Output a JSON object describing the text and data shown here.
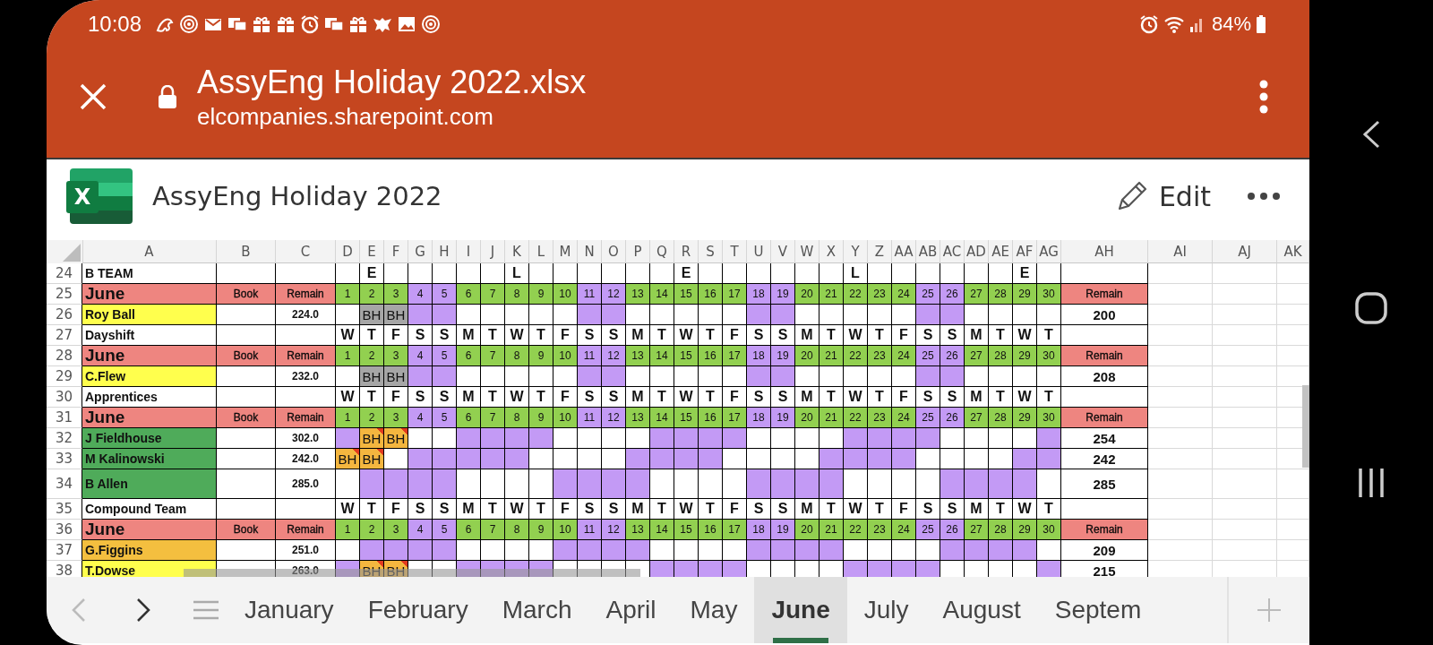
{
  "status_bar": {
    "time": "10:08",
    "battery": "84%"
  },
  "app_bar": {
    "title": "AssyEng Holiday 2022.xlsx",
    "url": "elcompanies.sharepoint.com"
  },
  "document": {
    "logo_letter": "X",
    "title": "AssyEng Holiday 2022",
    "edit_label": "Edit"
  },
  "sheet": {
    "columns": [
      "A",
      "B",
      "C",
      "D",
      "E",
      "F",
      "G",
      "H",
      "I",
      "J",
      "K",
      "L",
      "M",
      "N",
      "O",
      "P",
      "Q",
      "R",
      "S",
      "T",
      "U",
      "V",
      "W",
      "X",
      "Y",
      "Z",
      "AA",
      "AB",
      "AC",
      "AD",
      "AE",
      "AF",
      "AG",
      "AH",
      "AI",
      "AJ",
      "AK"
    ],
    "rows": [
      {
        "number": "24",
        "kind": "team",
        "label": "B TEAM",
        "cells": [
          {
            "kind": "blank"
          },
          {
            "kind": "mark",
            "text": "E"
          },
          {
            "kind": "blank"
          },
          {
            "kind": "blank"
          },
          {
            "kind": "blank"
          },
          {
            "kind": "blank"
          },
          {
            "kind": "blank"
          },
          {
            "kind": "mark",
            "text": "L"
          },
          {
            "kind": "blank"
          },
          {
            "kind": "blank"
          },
          {
            "kind": "blank"
          },
          {
            "kind": "blank"
          },
          {
            "kind": "blank"
          },
          {
            "kind": "blank"
          },
          {
            "kind": "mark",
            "text": "E"
          },
          {
            "kind": "blank"
          },
          {
            "kind": "blank"
          },
          {
            "kind": "blank"
          },
          {
            "kind": "blank"
          },
          {
            "kind": "blank"
          },
          {
            "kind": "blank"
          },
          {
            "kind": "mark",
            "text": "L"
          },
          {
            "kind": "blank"
          },
          {
            "kind": "blank"
          },
          {
            "kind": "blank"
          },
          {
            "kind": "blank"
          },
          {
            "kind": "blank"
          },
          {
            "kind": "blank"
          },
          {
            "kind": "mark",
            "text": "E"
          },
          {
            "kind": "blank"
          }
        ]
      },
      {
        "number": "25",
        "kind": "header",
        "month": "June",
        "book": "Book",
        "remain": "Remain",
        "total_label": "Remain",
        "days": [
          {
            "label": "1",
            "weekend": false
          },
          {
            "label": "2",
            "weekend": false
          },
          {
            "label": "3",
            "weekend": false
          },
          {
            "label": "4",
            "weekend": true
          },
          {
            "label": "5",
            "weekend": true
          },
          {
            "label": "6",
            "weekend": false
          },
          {
            "label": "7",
            "weekend": false
          },
          {
            "label": "8",
            "weekend": false
          },
          {
            "label": "9",
            "weekend": false
          },
          {
            "label": "10",
            "weekend": false
          },
          {
            "label": "11",
            "weekend": true
          },
          {
            "label": "12",
            "weekend": true
          },
          {
            "label": "13",
            "weekend": false
          },
          {
            "label": "14",
            "weekend": false
          },
          {
            "label": "15",
            "weekend": false
          },
          {
            "label": "16",
            "weekend": false
          },
          {
            "label": "17",
            "weekend": false
          },
          {
            "label": "18",
            "weekend": true
          },
          {
            "label": "19",
            "weekend": true
          },
          {
            "label": "20",
            "weekend": false
          },
          {
            "label": "21",
            "weekend": false
          },
          {
            "label": "22",
            "weekend": false
          },
          {
            "label": "23",
            "weekend": false
          },
          {
            "label": "24",
            "weekend": false
          },
          {
            "label": "25",
            "weekend": true
          },
          {
            "label": "26",
            "weekend": true
          },
          {
            "label": "27",
            "weekend": false
          },
          {
            "label": "28",
            "weekend": false
          },
          {
            "label": "29",
            "weekend": false
          },
          {
            "label": "30",
            "weekend": false
          }
        ]
      },
      {
        "number": "26",
        "kind": "person",
        "name": "Roy Ball",
        "color": "#ffff4d",
        "hours": "224.0",
        "total": "200",
        "days": [
          {
            "kind": "blank"
          },
          {
            "kind": "holiday",
            "text": "BH",
            "color": "#a6a6a6",
            "note": false
          },
          {
            "kind": "holiday",
            "text": "BH",
            "color": "#a6a6a6",
            "note": false
          },
          {
            "kind": "off"
          },
          {
            "kind": "off"
          },
          {
            "kind": "blank"
          },
          {
            "kind": "blank"
          },
          {
            "kind": "blank"
          },
          {
            "kind": "blank"
          },
          {
            "kind": "blank"
          },
          {
            "kind": "off"
          },
          {
            "kind": "off"
          },
          {
            "kind": "blank"
          },
          {
            "kind": "blank"
          },
          {
            "kind": "blank"
          },
          {
            "kind": "blank"
          },
          {
            "kind": "blank"
          },
          {
            "kind": "off"
          },
          {
            "kind": "off"
          },
          {
            "kind": "blank"
          },
          {
            "kind": "blank"
          },
          {
            "kind": "blank"
          },
          {
            "kind": "blank"
          },
          {
            "kind": "blank"
          },
          {
            "kind": "off"
          },
          {
            "kind": "off"
          },
          {
            "kind": "blank"
          },
          {
            "kind": "blank"
          },
          {
            "kind": "blank"
          },
          {
            "kind": "blank"
          }
        ]
      },
      {
        "number": "27",
        "kind": "weekdays",
        "label": "Dayshift",
        "days": [
          "W",
          "T",
          "F",
          "S",
          "S",
          "M",
          "T",
          "W",
          "T",
          "F",
          "S",
          "S",
          "M",
          "T",
          "W",
          "T",
          "F",
          "S",
          "S",
          "M",
          "T",
          "W",
          "T",
          "F",
          "S",
          "S",
          "M",
          "T",
          "W",
          "T"
        ]
      },
      {
        "number": "28",
        "kind": "header",
        "month": "June",
        "book": "Book",
        "remain": "Remain",
        "total_label": "Remain",
        "days": [
          {
            "label": "1",
            "weekend": false
          },
          {
            "label": "2",
            "weekend": false
          },
          {
            "label": "3",
            "weekend": false
          },
          {
            "label": "4",
            "weekend": true
          },
          {
            "label": "5",
            "weekend": true
          },
          {
            "label": "6",
            "weekend": false
          },
          {
            "label": "7",
            "weekend": false
          },
          {
            "label": "8",
            "weekend": false
          },
          {
            "label": "9",
            "weekend": false
          },
          {
            "label": "10",
            "weekend": false
          },
          {
            "label": "11",
            "weekend": true
          },
          {
            "label": "12",
            "weekend": true
          },
          {
            "label": "13",
            "weekend": false
          },
          {
            "label": "14",
            "weekend": false
          },
          {
            "label": "15",
            "weekend": false
          },
          {
            "label": "16",
            "weekend": false
          },
          {
            "label": "17",
            "weekend": false
          },
          {
            "label": "18",
            "weekend": true
          },
          {
            "label": "19",
            "weekend": true
          },
          {
            "label": "20",
            "weekend": false
          },
          {
            "label": "21",
            "weekend": false
          },
          {
            "label": "22",
            "weekend": false
          },
          {
            "label": "23",
            "weekend": false
          },
          {
            "label": "24",
            "weekend": false
          },
          {
            "label": "25",
            "weekend": true
          },
          {
            "label": "26",
            "weekend": true
          },
          {
            "label": "27",
            "weekend": false
          },
          {
            "label": "28",
            "weekend": false
          },
          {
            "label": "29",
            "weekend": false
          },
          {
            "label": "30",
            "weekend": false
          }
        ]
      },
      {
        "number": "29",
        "kind": "person",
        "name": "C.Flew",
        "color": "#ffff4d",
        "hours": "232.0",
        "total": "208",
        "days": [
          {
            "kind": "blank"
          },
          {
            "kind": "holiday",
            "text": "BH",
            "color": "#a6a6a6",
            "note": false
          },
          {
            "kind": "holiday",
            "text": "BH",
            "color": "#a6a6a6",
            "note": false
          },
          {
            "kind": "off"
          },
          {
            "kind": "off"
          },
          {
            "kind": "blank"
          },
          {
            "kind": "blank"
          },
          {
            "kind": "blank"
          },
          {
            "kind": "blank"
          },
          {
            "kind": "blank"
          },
          {
            "kind": "off"
          },
          {
            "kind": "off"
          },
          {
            "kind": "blank"
          },
          {
            "kind": "blank"
          },
          {
            "kind": "blank"
          },
          {
            "kind": "blank"
          },
          {
            "kind": "blank"
          },
          {
            "kind": "off"
          },
          {
            "kind": "off"
          },
          {
            "kind": "blank"
          },
          {
            "kind": "blank"
          },
          {
            "kind": "blank"
          },
          {
            "kind": "blank"
          },
          {
            "kind": "blank"
          },
          {
            "kind": "off"
          },
          {
            "kind": "off"
          },
          {
            "kind": "blank"
          },
          {
            "kind": "blank"
          },
          {
            "kind": "blank"
          },
          {
            "kind": "blank"
          }
        ]
      },
      {
        "number": "30",
        "kind": "weekdays",
        "label": "Apprentices",
        "days": [
          "W",
          "T",
          "F",
          "S",
          "S",
          "M",
          "T",
          "W",
          "T",
          "F",
          "S",
          "S",
          "M",
          "T",
          "W",
          "T",
          "F",
          "S",
          "S",
          "M",
          "T",
          "W",
          "T",
          "F",
          "S",
          "S",
          "M",
          "T",
          "W",
          "T"
        ]
      },
      {
        "number": "31",
        "kind": "header",
        "month": "June",
        "book": "Book",
        "remain": "Remain",
        "total_label": "Remain",
        "days": [
          {
            "label": "1",
            "weekend": false
          },
          {
            "label": "2",
            "weekend": false
          },
          {
            "label": "3",
            "weekend": false
          },
          {
            "label": "4",
            "weekend": true
          },
          {
            "label": "5",
            "weekend": true
          },
          {
            "label": "6",
            "weekend": false
          },
          {
            "label": "7",
            "weekend": false
          },
          {
            "label": "8",
            "weekend": false
          },
          {
            "label": "9",
            "weekend": false
          },
          {
            "label": "10",
            "weekend": false
          },
          {
            "label": "11",
            "weekend": true
          },
          {
            "label": "12",
            "weekend": true
          },
          {
            "label": "13",
            "weekend": false
          },
          {
            "label": "14",
            "weekend": false
          },
          {
            "label": "15",
            "weekend": false
          },
          {
            "label": "16",
            "weekend": false
          },
          {
            "label": "17",
            "weekend": false
          },
          {
            "label": "18",
            "weekend": true
          },
          {
            "label": "19",
            "weekend": true
          },
          {
            "label": "20",
            "weekend": false
          },
          {
            "label": "21",
            "weekend": false
          },
          {
            "label": "22",
            "weekend": false
          },
          {
            "label": "23",
            "weekend": false
          },
          {
            "label": "24",
            "weekend": false
          },
          {
            "label": "25",
            "weekend": true
          },
          {
            "label": "26",
            "weekend": true
          },
          {
            "label": "27",
            "weekend": false
          },
          {
            "label": "28",
            "weekend": false
          },
          {
            "label": "29",
            "weekend": false
          },
          {
            "label": "30",
            "weekend": false
          }
        ]
      },
      {
        "number": "32",
        "kind": "person",
        "name": "J Fieldhouse",
        "color": "#4fab5a",
        "hours": "302.0",
        "total": "254",
        "days": [
          {
            "kind": "off"
          },
          {
            "kind": "holiday",
            "text": "BH",
            "color": "#f4b63f",
            "note": true
          },
          {
            "kind": "holiday",
            "text": "BH",
            "color": "#f4b63f",
            "note": true
          },
          {
            "kind": "blank"
          },
          {
            "kind": "blank"
          },
          {
            "kind": "off"
          },
          {
            "kind": "off"
          },
          {
            "kind": "off"
          },
          {
            "kind": "off"
          },
          {
            "kind": "blank"
          },
          {
            "kind": "blank"
          },
          {
            "kind": "blank"
          },
          {
            "kind": "blank"
          },
          {
            "kind": "off"
          },
          {
            "kind": "off"
          },
          {
            "kind": "off"
          },
          {
            "kind": "off"
          },
          {
            "kind": "blank"
          },
          {
            "kind": "blank"
          },
          {
            "kind": "blank"
          },
          {
            "kind": "blank"
          },
          {
            "kind": "off"
          },
          {
            "kind": "off"
          },
          {
            "kind": "off"
          },
          {
            "kind": "off"
          },
          {
            "kind": "blank"
          },
          {
            "kind": "blank"
          },
          {
            "kind": "blank"
          },
          {
            "kind": "blank"
          },
          {
            "kind": "off"
          }
        ]
      },
      {
        "number": "33",
        "kind": "person",
        "name": "M Kalinowski",
        "color": "#4fab5a",
        "hours": "242.0",
        "total": "242",
        "days": [
          {
            "kind": "holiday",
            "text": "BH",
            "color": "#f4b63f",
            "note": true
          },
          {
            "kind": "holiday",
            "text": "BH",
            "color": "#f4b63f",
            "note": true
          },
          {
            "kind": "blank"
          },
          {
            "kind": "off"
          },
          {
            "kind": "off"
          },
          {
            "kind": "off"
          },
          {
            "kind": "off"
          },
          {
            "kind": "off"
          },
          {
            "kind": "blank"
          },
          {
            "kind": "blank"
          },
          {
            "kind": "blank"
          },
          {
            "kind": "blank"
          },
          {
            "kind": "off"
          },
          {
            "kind": "off"
          },
          {
            "kind": "off"
          },
          {
            "kind": "off"
          },
          {
            "kind": "blank"
          },
          {
            "kind": "blank"
          },
          {
            "kind": "blank"
          },
          {
            "kind": "blank"
          },
          {
            "kind": "off"
          },
          {
            "kind": "off"
          },
          {
            "kind": "off"
          },
          {
            "kind": "off"
          },
          {
            "kind": "blank"
          },
          {
            "kind": "blank"
          },
          {
            "kind": "blank"
          },
          {
            "kind": "blank"
          },
          {
            "kind": "off"
          },
          {
            "kind": "off"
          }
        ]
      },
      {
        "number": "34",
        "kind": "person",
        "tall": true,
        "name": "B Allen",
        "color": "#4fab5a",
        "hours": "285.0",
        "total": "285",
        "days": [
          {
            "kind": "blank"
          },
          {
            "kind": "off"
          },
          {
            "kind": "off"
          },
          {
            "kind": "off"
          },
          {
            "kind": "off"
          },
          {
            "kind": "blank"
          },
          {
            "kind": "blank"
          },
          {
            "kind": "blank"
          },
          {
            "kind": "blank"
          },
          {
            "kind": "off"
          },
          {
            "kind": "off"
          },
          {
            "kind": "off"
          },
          {
            "kind": "off"
          },
          {
            "kind": "blank"
          },
          {
            "kind": "blank"
          },
          {
            "kind": "blank"
          },
          {
            "kind": "blank"
          },
          {
            "kind": "off"
          },
          {
            "kind": "off"
          },
          {
            "kind": "off"
          },
          {
            "kind": "off"
          },
          {
            "kind": "blank"
          },
          {
            "kind": "blank"
          },
          {
            "kind": "blank"
          },
          {
            "kind": "blank"
          },
          {
            "kind": "off"
          },
          {
            "kind": "off"
          },
          {
            "kind": "off"
          },
          {
            "kind": "off"
          },
          {
            "kind": "blank"
          }
        ]
      },
      {
        "number": "35",
        "kind": "weekdays",
        "label": "Compound Team",
        "days": [
          "W",
          "T",
          "F",
          "S",
          "S",
          "M",
          "T",
          "W",
          "T",
          "F",
          "S",
          "S",
          "M",
          "T",
          "W",
          "T",
          "F",
          "S",
          "S",
          "M",
          "T",
          "W",
          "T",
          "F",
          "S",
          "S",
          "M",
          "T",
          "W",
          "T"
        ]
      },
      {
        "number": "36",
        "kind": "header",
        "month": "June",
        "book": "Book",
        "remain": "Remain",
        "total_label": "Remain",
        "days": [
          {
            "label": "1",
            "weekend": false
          },
          {
            "label": "2",
            "weekend": false
          },
          {
            "label": "3",
            "weekend": false
          },
          {
            "label": "4",
            "weekend": true
          },
          {
            "label": "5",
            "weekend": true
          },
          {
            "label": "6",
            "weekend": false
          },
          {
            "label": "7",
            "weekend": false
          },
          {
            "label": "8",
            "weekend": false
          },
          {
            "label": "9",
            "weekend": false
          },
          {
            "label": "10",
            "weekend": false
          },
          {
            "label": "11",
            "weekend": true
          },
          {
            "label": "12",
            "weekend": true
          },
          {
            "label": "13",
            "weekend": false
          },
          {
            "label": "14",
            "weekend": false
          },
          {
            "label": "15",
            "weekend": false
          },
          {
            "label": "16",
            "weekend": false
          },
          {
            "label": "17",
            "weekend": false
          },
          {
            "label": "18",
            "weekend": true
          },
          {
            "label": "19",
            "weekend": true
          },
          {
            "label": "20",
            "weekend": false
          },
          {
            "label": "21",
            "weekend": false
          },
          {
            "label": "22",
            "weekend": false
          },
          {
            "label": "23",
            "weekend": false
          },
          {
            "label": "24",
            "weekend": false
          },
          {
            "label": "25",
            "weekend": true
          },
          {
            "label": "26",
            "weekend": true
          },
          {
            "label": "27",
            "weekend": false
          },
          {
            "label": "28",
            "weekend": false
          },
          {
            "label": "29",
            "weekend": false
          },
          {
            "label": "30",
            "weekend": false
          }
        ]
      },
      {
        "number": "37",
        "kind": "person",
        "name": "G.Figgins",
        "color": "#f4bf3f",
        "hours": "251.0",
        "total": "209",
        "days": [
          {
            "kind": "blank"
          },
          {
            "kind": "off"
          },
          {
            "kind": "off"
          },
          {
            "kind": "off"
          },
          {
            "kind": "off"
          },
          {
            "kind": "blank"
          },
          {
            "kind": "blank"
          },
          {
            "kind": "blank"
          },
          {
            "kind": "blank"
          },
          {
            "kind": "off"
          },
          {
            "kind": "off"
          },
          {
            "kind": "off"
          },
          {
            "kind": "off"
          },
          {
            "kind": "blank"
          },
          {
            "kind": "blank"
          },
          {
            "kind": "blank"
          },
          {
            "kind": "blank"
          },
          {
            "kind": "off"
          },
          {
            "kind": "off"
          },
          {
            "kind": "off"
          },
          {
            "kind": "off"
          },
          {
            "kind": "blank"
          },
          {
            "kind": "blank"
          },
          {
            "kind": "blank"
          },
          {
            "kind": "blank"
          },
          {
            "kind": "off"
          },
          {
            "kind": "off"
          },
          {
            "kind": "off"
          },
          {
            "kind": "off"
          },
          {
            "kind": "blank"
          }
        ]
      },
      {
        "number": "38",
        "kind": "person",
        "name": "T.Dowse",
        "color": "#ffff4d",
        "hours": "263.0",
        "total": "215",
        "days": [
          {
            "kind": "off"
          },
          {
            "kind": "holiday",
            "text": "BH",
            "color": "#f4b63f",
            "note": true
          },
          {
            "kind": "holiday",
            "text": "BH",
            "color": "#f4b63f",
            "note": true
          },
          {
            "kind": "blank"
          },
          {
            "kind": "blank"
          },
          {
            "kind": "off"
          },
          {
            "kind": "off"
          },
          {
            "kind": "off"
          },
          {
            "kind": "off"
          },
          {
            "kind": "blank"
          },
          {
            "kind": "blank"
          },
          {
            "kind": "blank"
          },
          {
            "kind": "blank"
          },
          {
            "kind": "off"
          },
          {
            "kind": "off"
          },
          {
            "kind": "off"
          },
          {
            "kind": "off"
          },
          {
            "kind": "blank"
          },
          {
            "kind": "blank"
          },
          {
            "kind": "blank"
          },
          {
            "kind": "blank"
          },
          {
            "kind": "off"
          },
          {
            "kind": "off"
          },
          {
            "kind": "off"
          },
          {
            "kind": "off"
          },
          {
            "kind": "blank"
          },
          {
            "kind": "blank"
          },
          {
            "kind": "blank"
          },
          {
            "kind": "blank"
          },
          {
            "kind": "off"
          }
        ]
      }
    ]
  },
  "sheet_tabs": [
    {
      "label": "January",
      "selected": false
    },
    {
      "label": "February",
      "selected": false
    },
    {
      "label": "March",
      "selected": false
    },
    {
      "label": "April",
      "selected": false
    },
    {
      "label": "May",
      "selected": false
    },
    {
      "label": "June",
      "selected": true
    },
    {
      "label": "July",
      "selected": false
    },
    {
      "label": "August",
      "selected": false
    },
    {
      "label": "Septem",
      "selected": false
    }
  ]
}
